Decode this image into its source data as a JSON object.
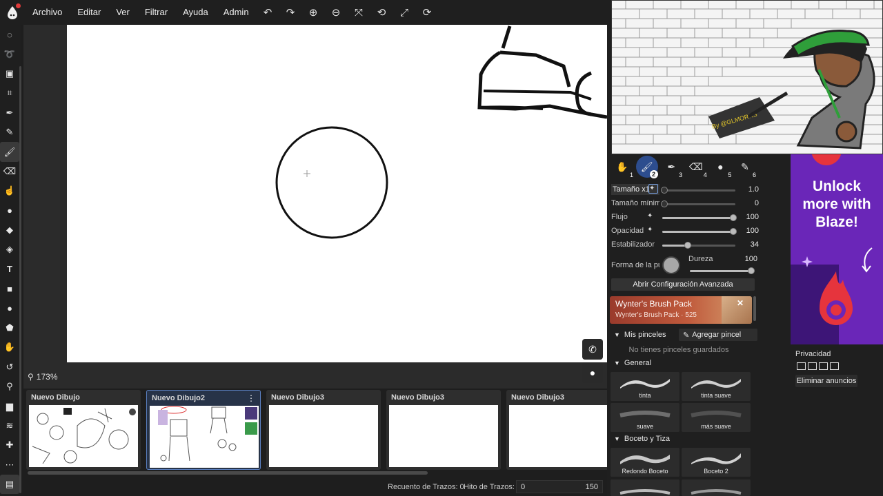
{
  "menu": {
    "items": [
      "Archivo",
      "Editar",
      "Ver",
      "Filtrar",
      "Ayuda",
      "Admin"
    ],
    "toolbar_icons": [
      "undo-icon",
      "redo-icon",
      "zoom-in-icon",
      "zoom-out-icon",
      "fit-icon",
      "rotate-icon",
      "fullscreen-icon",
      "reset-view-icon"
    ]
  },
  "tools": [
    "lasso-select-icon",
    "lasso-icon",
    "transform-icon",
    "crop-icon",
    "eyedropper-icon",
    "pen-icon",
    "brush-icon",
    "eraser-icon",
    "smudge-icon",
    "blur-icon",
    "fill-icon",
    "gradient-icon",
    "text-icon",
    "rectangle-icon",
    "ellipse-icon",
    "shape-icon",
    "hand-icon",
    "rotate-icon",
    "zoom-icon",
    "comment-icon",
    "layers-icon",
    "add-icon",
    "more-icon",
    "film-icon"
  ],
  "canvas": {
    "zoom_label": "173%"
  },
  "documents": [
    {
      "title": "Nuevo Dibujo",
      "active": false
    },
    {
      "title": "Nuevo Dibujo2",
      "active": true
    },
    {
      "title": "Nuevo Dibujo3",
      "active": false
    },
    {
      "title": "Nuevo Dibujo3",
      "active": false
    },
    {
      "title": "Nuevo Dibujo3",
      "active": false
    }
  ],
  "status": {
    "stroke_count_label": "Recuento de Trazos: 0",
    "stroke_goal_label": "Hito de Trazos:",
    "stroke_goal_value": "0",
    "stroke_goal_max": "150"
  },
  "brush_presets": [
    "1",
    "2",
    "3",
    "4",
    "5",
    "6"
  ],
  "brush_settings": {
    "size": {
      "label": "Tamaño x1",
      "value": "1.0",
      "fraction": 0.0
    },
    "min_size": {
      "label": "Tamaño mínimo",
      "value": "0",
      "fraction": 0.0
    },
    "flow": {
      "label": "Flujo",
      "value": "100",
      "fraction": 1.0
    },
    "opacity": {
      "label": "Opacidad",
      "value": "100",
      "fraction": 1.0
    },
    "stabilizer": {
      "label": "Estabilizador",
      "value": "34",
      "fraction": 0.34
    },
    "tip_shape_label": "Forma de la punta",
    "hardness_label": "Dureza",
    "hardness_value": "100",
    "advanced_button": "Abrir Configuración Avanzada"
  },
  "pack": {
    "title": "Wynter's Brush Pack",
    "subtitle": "Wynter's Brush Pack · 525"
  },
  "my_brushes": {
    "header": "Mis pinceles",
    "add_button": "Agregar pincel",
    "empty_message": "No tienes pinceles guardados"
  },
  "general": {
    "header": "General",
    "brushes": [
      "tinta",
      "tinta suave",
      "suave",
      "más suave"
    ]
  },
  "sketch": {
    "header": "Boceto y Tiza",
    "brushes": [
      "Redondo Boceto",
      "Boceto 2"
    ]
  },
  "ad": {
    "text": "Unlock more with Blaze!",
    "privacy_label": "Privacidad",
    "remove_ads_button": "Eliminar anuncios"
  },
  "colors": {
    "accent": "#2d4d8e",
    "panel": "#1f1f1f",
    "ad_purple": "#6a26b8"
  }
}
